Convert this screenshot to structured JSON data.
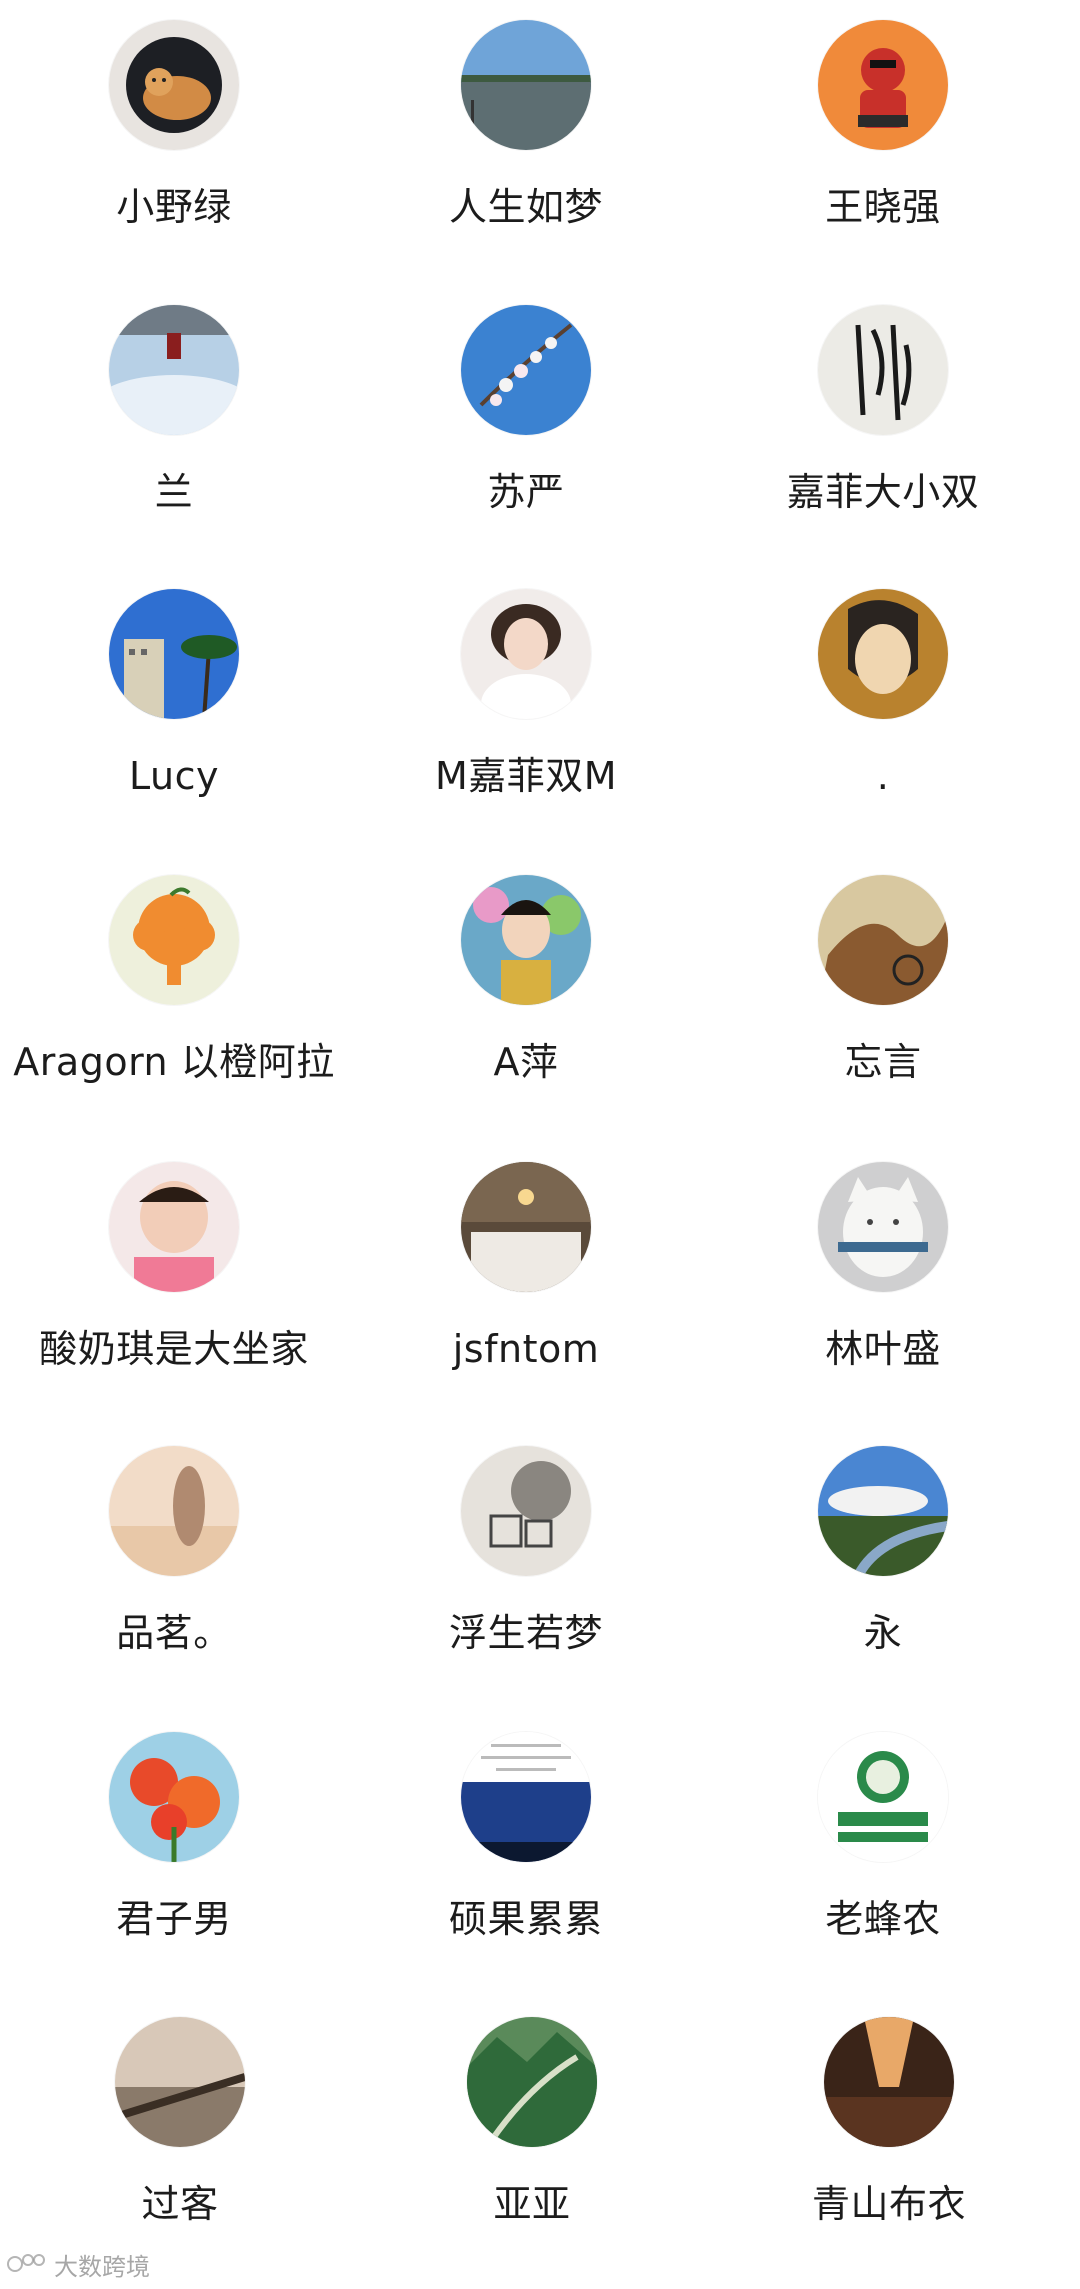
{
  "contacts": [
    {
      "name": "小野绿",
      "avatar": "cat-in-washer-avatar"
    },
    {
      "name": "人生如梦",
      "avatar": "lake-view-avatar"
    },
    {
      "name": "王晓强",
      "avatar": "cartoon-hero-avatar"
    },
    {
      "name": "兰",
      "avatar": "sky-hanging-avatar"
    },
    {
      "name": "苏严",
      "avatar": "blossom-sky-avatar"
    },
    {
      "name": "嘉菲大小双",
      "avatar": "calligraphy-avatar"
    },
    {
      "name": "Lucy",
      "avatar": "city-palm-avatar"
    },
    {
      "name": "M嘉菲双M",
      "avatar": "girl-portrait-avatar"
    },
    {
      "name": ".",
      "avatar": "anime-boy-avatar"
    },
    {
      "name": "Aragorn 以橙阿拉",
      "avatar": "orange-tree-logo-avatar"
    },
    {
      "name": "A萍",
      "avatar": "costume-girl-avatar"
    },
    {
      "name": "忘言",
      "avatar": "mural-painting-avatar"
    },
    {
      "name": "酸奶琪是大坐家",
      "avatar": "baby-photo-avatar"
    },
    {
      "name": "jsfntom",
      "avatar": "hotel-room-avatar"
    },
    {
      "name": "林叶盛",
      "avatar": "white-cat-avatar"
    },
    {
      "name": "品茗。",
      "avatar": "beach-woman-avatar"
    },
    {
      "name": "浮生若梦",
      "avatar": "stone-seal-avatar"
    },
    {
      "name": "永",
      "avatar": "river-clouds-avatar"
    },
    {
      "name": "君子男",
      "avatar": "red-flowers-avatar"
    },
    {
      "name": "硕果累累",
      "avatar": "night-sky-text-avatar"
    },
    {
      "name": "老蜂农",
      "avatar": "beemaster-logo-avatar"
    },
    {
      "name": "过客",
      "avatar": "pier-sunset-avatar"
    },
    {
      "name": "亚亚",
      "avatar": "mountain-road-avatar"
    },
    {
      "name": "青山布衣",
      "avatar": "canyon-avatar"
    }
  ],
  "watermark": {
    "text": "大数跨境"
  },
  "colors": {
    "background": "#ffffff",
    "name_text": "#1c1c1c"
  }
}
